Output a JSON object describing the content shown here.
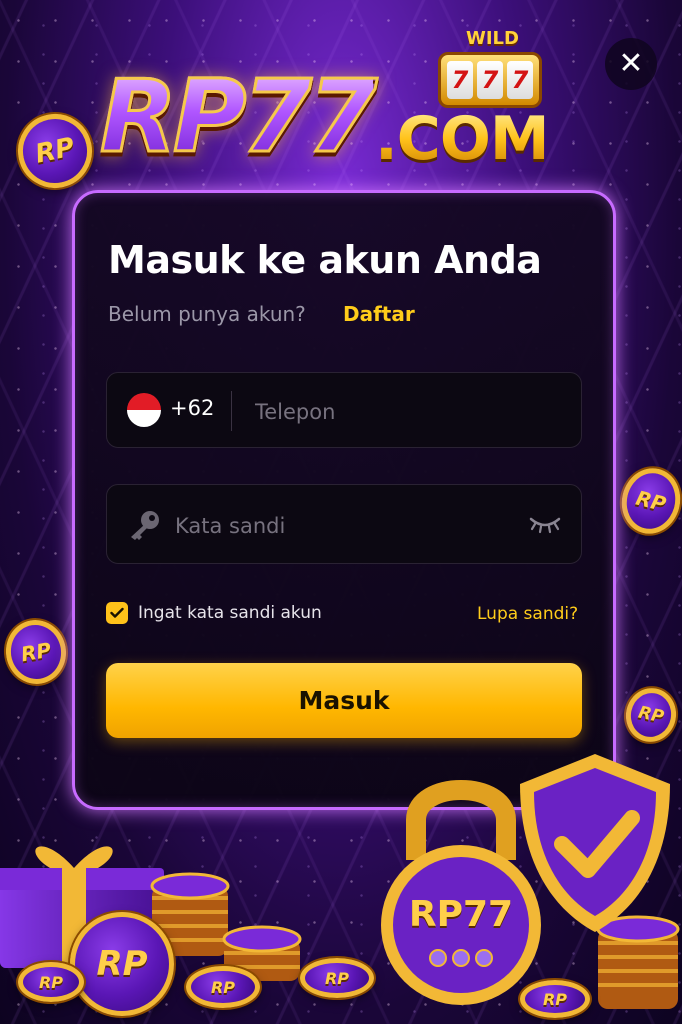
{
  "brand": {
    "name_main": "RP77",
    "name_suffix": ".COM",
    "slot_label": "WILD",
    "slot_reels": [
      "7",
      "7",
      "7"
    ],
    "coin_text": "RP",
    "padlock_text": "RP77"
  },
  "close": {
    "icon": "close-icon",
    "label": "✕"
  },
  "login": {
    "title": "Masuk ke akun Anda",
    "subtitle": "Belum punya akun?",
    "register_link": "Daftar",
    "phone": {
      "country_code": "+62",
      "flag": "indonesia-flag-icon",
      "placeholder": "Telepon",
      "value": ""
    },
    "password": {
      "placeholder": "Kata sandi",
      "value": "",
      "leading_icon": "key-icon",
      "toggle_icon": "eye-closed-icon"
    },
    "remember": {
      "label": "Ingat kata sandi akun",
      "checked": true
    },
    "forgot": "Lupa sandi?",
    "submit": "Masuk"
  },
  "colors": {
    "accent": "#ffc21a",
    "card_border": "#c76bff",
    "background": "#3c0f7a",
    "card_bg": "#14081f"
  }
}
